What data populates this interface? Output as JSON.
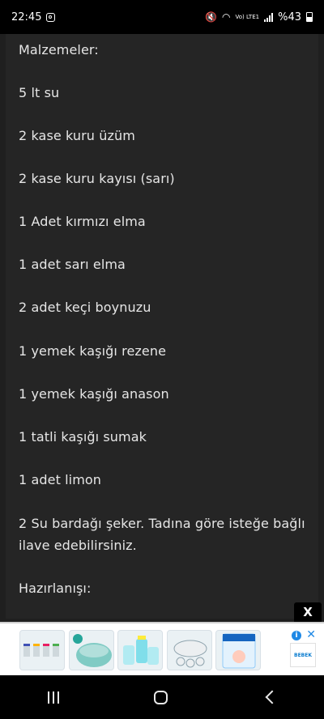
{
  "status_bar": {
    "time": "22:45",
    "battery_text": "%43",
    "volte_label": "Vo) LTE1"
  },
  "recipe": {
    "lines": [
      "Malzemeler:",
      "5 lt su",
      "2  kase kuru üzüm",
      "2  kase kuru kayısı (sarı)",
      "1 Adet kırmızı elma",
      "1 adet sarı elma",
      "2 adet keçi boynuzu",
      "1 yemek kaşığı rezene",
      "1 yemek kaşığı anason",
      "1 tatli kaşığı sumak",
      "1 adet limon",
      "2 Su bardağı şeker.  Tadına göre isteğe bağlı",
      "ilave edebilirsiniz.",
      "Hazırlanışı:"
    ]
  },
  "ad": {
    "close_label": "X",
    "brand_label": "BEBEK"
  },
  "colors": {
    "page_bg": "#1f1f1f",
    "content_bg": "#252525",
    "text": "#e6e6e6",
    "ad_accent": "#1e88e5"
  }
}
